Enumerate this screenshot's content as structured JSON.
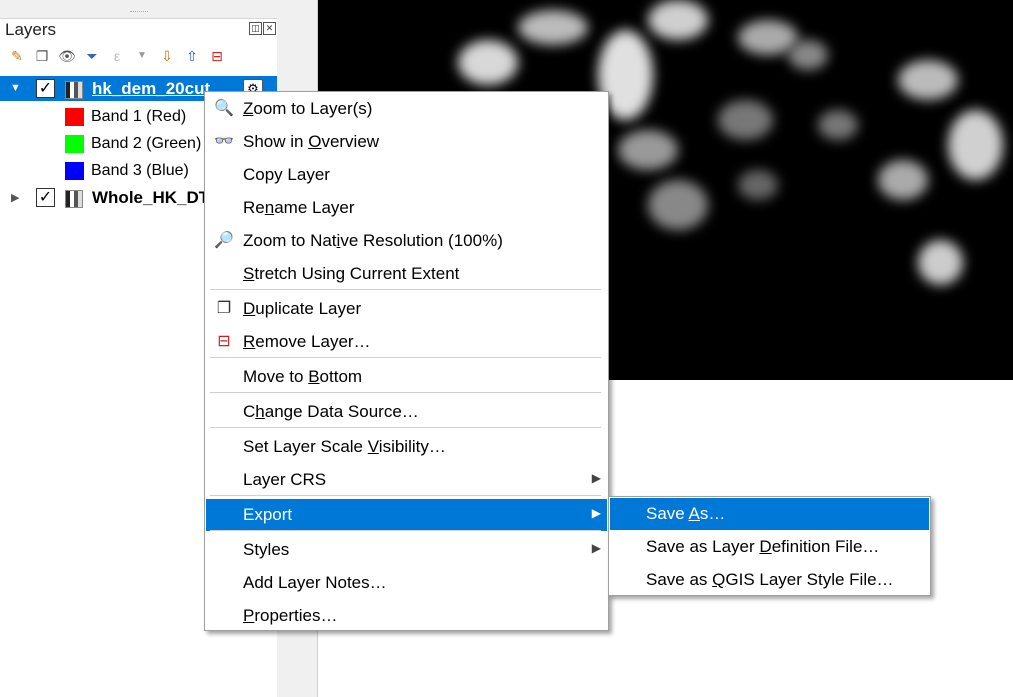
{
  "panel": {
    "title": "Layers",
    "toolbar_icons": [
      "open-layer-styling-icon",
      "add-group-icon",
      "manage-visibility-icon",
      "filter-legend-icon",
      "filter-expression-icon",
      "dropdown-icon",
      "expand-all-icon",
      "collapse-all-icon",
      "remove-layer-icon"
    ]
  },
  "tree": {
    "layers": [
      {
        "name": "hk_dem_20cut",
        "checked": "✓",
        "expanded": "▼"
      },
      {
        "name": "Whole_HK_DT",
        "checked": "✓",
        "expanded": "▶"
      }
    ],
    "bands": [
      {
        "label": "Band 1 (Red)",
        "color": "#ff0000"
      },
      {
        "label": "Band 2 (Green)",
        "color": "#00ff00"
      },
      {
        "label": "Band 3 (Blue)",
        "color": "#0000ff"
      }
    ]
  },
  "context_menu": {
    "items": [
      {
        "pre": "",
        "u": "Z",
        "post": "oom to Layer(s)",
        "icon": "zoom-to-layer-icon"
      },
      {
        "pre": "Show in ",
        "u": "O",
        "post": "verview",
        "icon": "show-in-overview-icon"
      },
      {
        "pre": "Copy Layer",
        "u": "",
        "post": ""
      },
      {
        "pre": "Re",
        "u": "n",
        "post": "ame Layer"
      },
      {
        "pre": "Zoom to Nat",
        "u": "i",
        "post": "ve Resolution (100%)",
        "icon": "zoom-native-icon"
      },
      {
        "pre": "",
        "u": "S",
        "post": "tretch Using Current Extent"
      },
      {
        "pre": "",
        "u": "D",
        "post": "uplicate Layer",
        "icon": "duplicate-layer-icon"
      },
      {
        "pre": "",
        "u": "R",
        "post": "emove Layer…",
        "icon": "remove-layer-icon"
      },
      {
        "pre": "Move to ",
        "u": "B",
        "post": "ottom"
      },
      {
        "pre": "C",
        "u": "h",
        "post": "ange Data Source…"
      },
      {
        "pre": "Set Layer Scale ",
        "u": "V",
        "post": "isibility…"
      },
      {
        "pre": "Layer CRS",
        "u": "",
        "post": ""
      },
      {
        "pre": "Export",
        "u": "",
        "post": ""
      },
      {
        "pre": "Styles",
        "u": "",
        "post": ""
      },
      {
        "pre": "Add Layer Notes…",
        "u": "",
        "post": ""
      },
      {
        "pre": "",
        "u": "P",
        "post": "roperties…"
      }
    ]
  },
  "export_submenu": {
    "items": [
      {
        "pre": "Save ",
        "u": "A",
        "post": "s…"
      },
      {
        "pre": "Save as Layer ",
        "u": "D",
        "post": "efinition File…"
      },
      {
        "pre": "Save as ",
        "u": "Q",
        "post": "GIS Layer Style File…"
      }
    ]
  },
  "colors": {
    "highlight": "#0078d7"
  }
}
